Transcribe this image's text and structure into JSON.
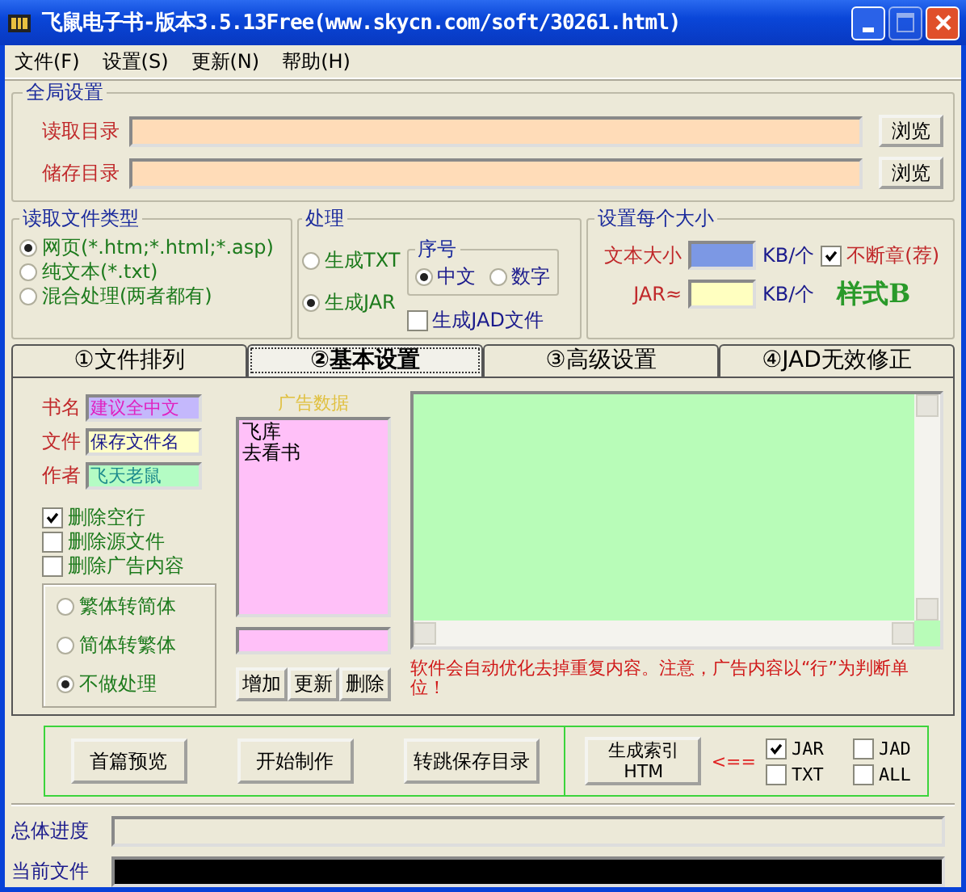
{
  "window": {
    "title": "飞鼠电子书-版本3.5.13Free(www.skycn.com/soft/30261.html)"
  },
  "menu": [
    {
      "label": "文件(F)"
    },
    {
      "label": "设置(S)"
    },
    {
      "label": "更新(N)"
    },
    {
      "label": "帮助(H)"
    }
  ],
  "global_settings": {
    "title": "全局设置",
    "rows": [
      {
        "label": "读取目录",
        "button": "浏览"
      },
      {
        "label": "储存目录",
        "button": "浏览"
      }
    ]
  },
  "file_type": {
    "title": "读取文件类型",
    "options": [
      {
        "label": "网页(*.htm;*.html;*.asp)",
        "selected": true
      },
      {
        "label": "纯文本(*.txt)",
        "selected": false
      },
      {
        "label": "混合处理(两者都有)",
        "selected": false
      }
    ]
  },
  "process": {
    "title": "处理",
    "options": [
      {
        "label": "生成TXT",
        "selected": false
      },
      {
        "label": "生成JAR",
        "selected": true
      }
    ],
    "generate_jad": {
      "label": "生成JAD文件",
      "checked": false
    }
  },
  "numbering": {
    "title": "序号",
    "options": [
      {
        "label": "中文",
        "selected": true
      },
      {
        "label": "数字",
        "selected": false
      }
    ]
  },
  "size": {
    "title": "设置每个大小",
    "text_size": {
      "label": "文本大小",
      "unit": "KB/个"
    },
    "jar": {
      "label": "JAR≈",
      "unit": "KB/个"
    },
    "no_break": {
      "label": "不断章(荐)",
      "checked": true
    },
    "style": "样式B"
  },
  "tabs": [
    {
      "label": "①文件排列",
      "selected": false
    },
    {
      "label": "②基本设置",
      "selected": true
    },
    {
      "label": "③高级设置",
      "selected": false
    },
    {
      "label": "④JAD无效修正",
      "selected": false
    }
  ],
  "basic": {
    "fields": [
      {
        "label": "书名",
        "value": "建议全中文"
      },
      {
        "label": "文件",
        "value": "保存文件名"
      },
      {
        "label": "作者",
        "value": "飞天老鼠"
      }
    ],
    "options": [
      {
        "label": "删除空行",
        "checked": true
      },
      {
        "label": "删除源文件",
        "checked": false
      },
      {
        "label": "删除广告内容",
        "checked": false
      }
    ],
    "conversion": [
      {
        "label": "繁体转简体",
        "selected": false
      },
      {
        "label": "简体转繁体",
        "selected": false
      },
      {
        "label": "不做处理",
        "selected": true
      }
    ],
    "ad_data": {
      "title": "广告数据",
      "items": [
        "飞库",
        "去看书"
      ],
      "buttons": [
        "增加",
        "更新",
        "删除"
      ]
    },
    "notice": "软件会自动优化去掉重复内容。注意，广告内容以“行”为判断单位！"
  },
  "actions": {
    "buttons": [
      "首篇预览",
      "开始制作",
      "转跳保存目录"
    ],
    "index_button": [
      "生成索引",
      "HTM"
    ],
    "arrow": "<==",
    "formats": [
      {
        "label": "JAR",
        "checked": true
      },
      {
        "label": "JAD",
        "checked": false
      },
      {
        "label": "TXT",
        "checked": false
      },
      {
        "label": "ALL",
        "checked": false
      }
    ]
  },
  "progress": [
    {
      "label": "总体进度",
      "level": 0
    },
    {
      "label": "当前文件",
      "level": 1
    }
  ]
}
